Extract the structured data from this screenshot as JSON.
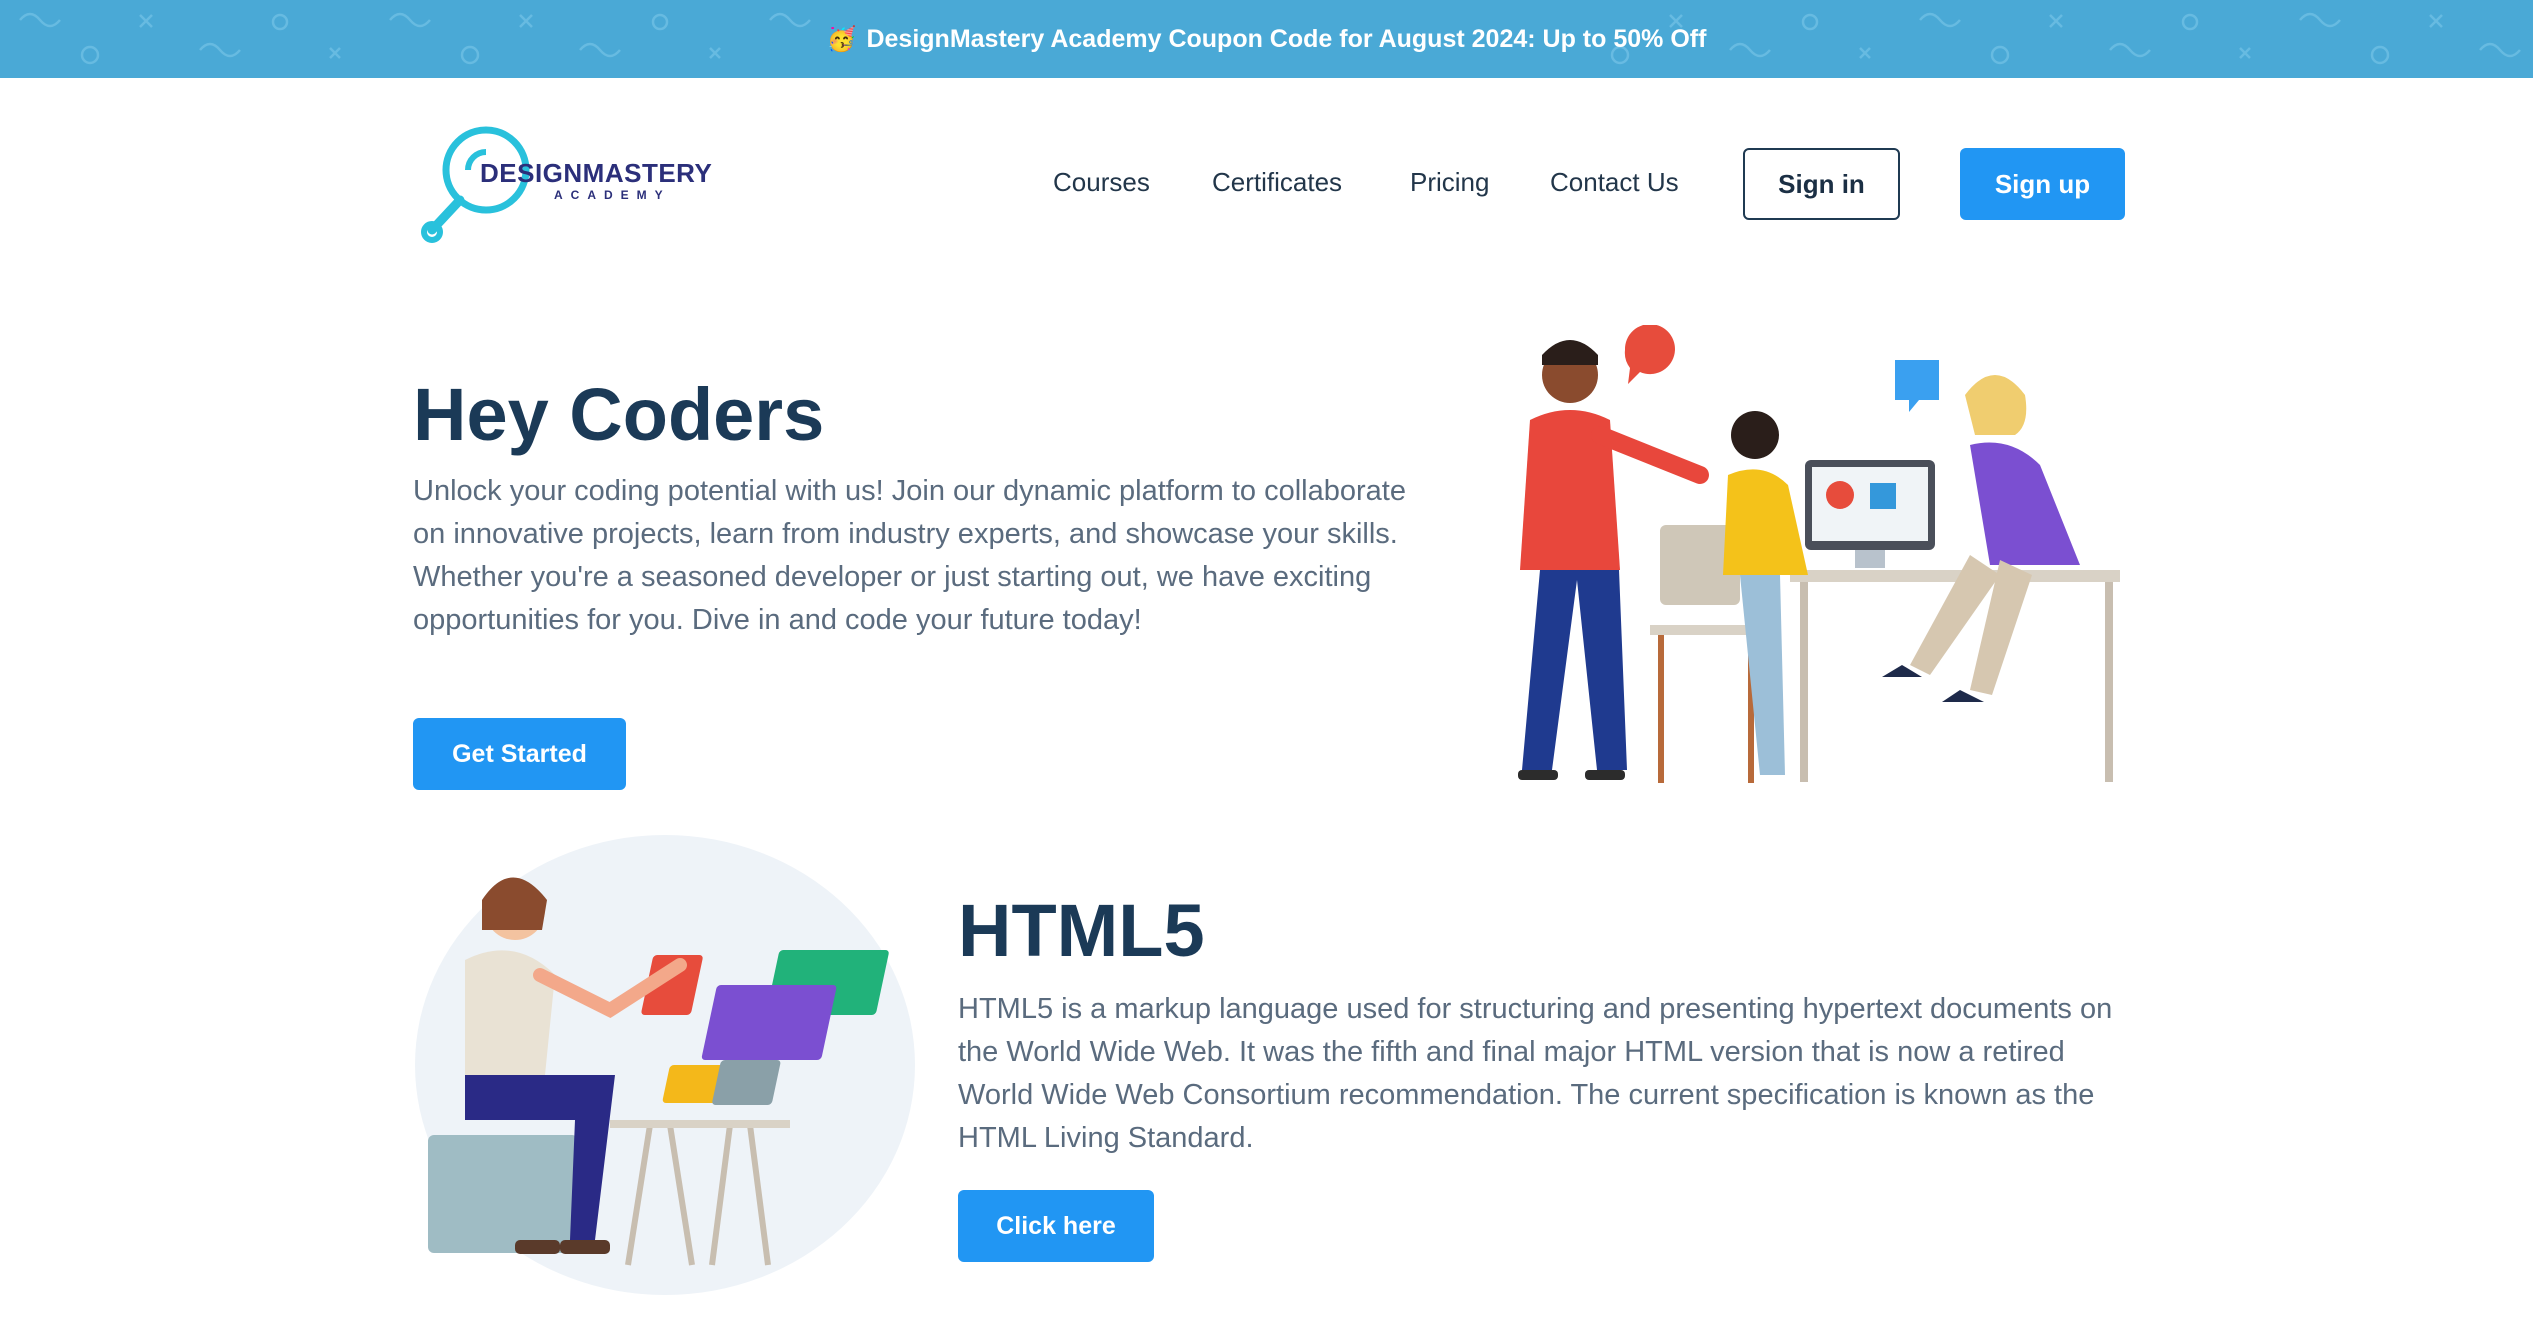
{
  "promo": {
    "emoji": "🥳",
    "text": "DesignMastery Academy Coupon Code for August 2024: Up to 50% Off"
  },
  "logo": {
    "name": "DESIGNMASTERY",
    "sub": "ACADEMY"
  },
  "nav": {
    "items": [
      {
        "label": "Courses"
      },
      {
        "label": "Certificates"
      },
      {
        "label": "Pricing"
      },
      {
        "label": "Contact Us"
      }
    ],
    "signin_label": "Sign in",
    "signup_label": "Sign up"
  },
  "hero": {
    "title": "Hey Coders",
    "text": "Unlock your coding potential with us! Join our dynamic platform to collaborate on innovative projects, learn from industry experts, and showcase your skills. Whether you're a seasoned developer or just starting out, we have exciting opportunities for you. Dive in and code your future today!",
    "cta_label": "Get Started"
  },
  "html5": {
    "title": "HTML5",
    "text": "HTML5 is a markup language used for structuring and presenting hypertext documents on the World Wide Web. It was the fifth and final major HTML version that is now a retired World Wide Web Consortium recommendation. The current specification is known as the HTML Living Standard.",
    "cta_label": "Click here"
  },
  "colors": {
    "banner": "#4aa9d6",
    "primary": "#2196f3",
    "heading": "#1b3a57",
    "body_text": "#5a6b7e"
  }
}
